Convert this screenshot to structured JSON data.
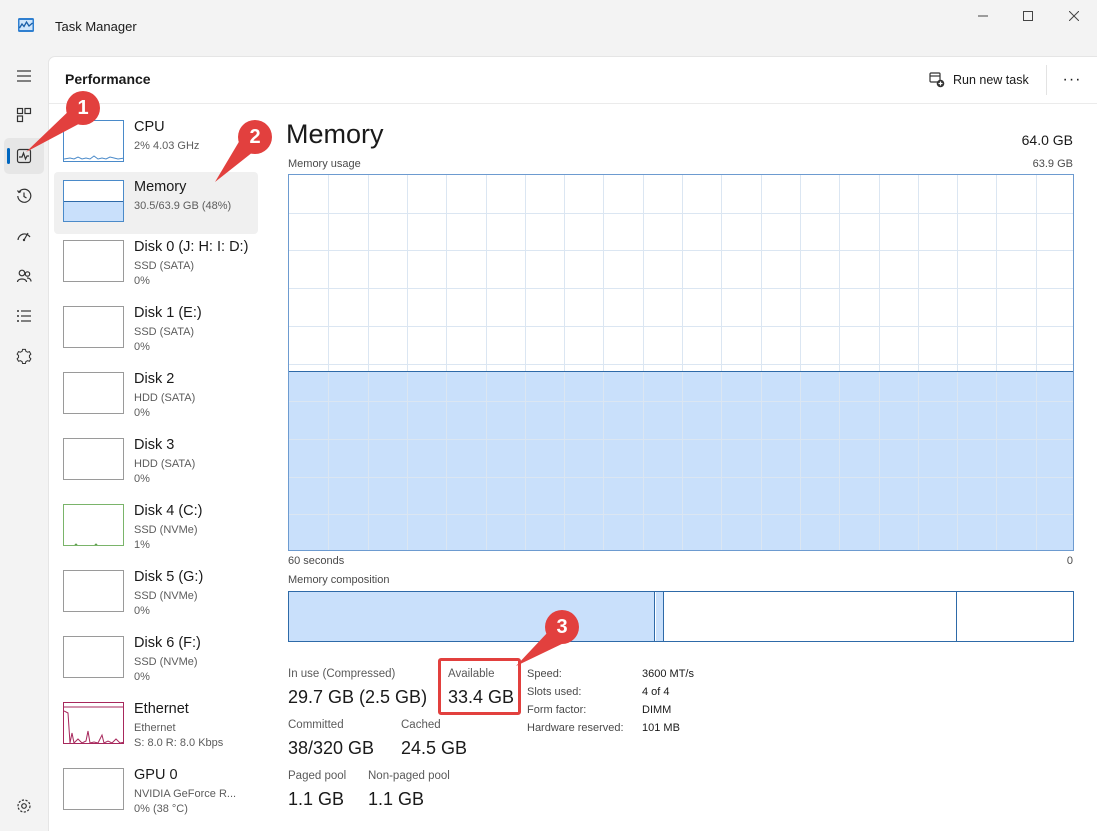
{
  "window": {
    "title": "Task Manager",
    "minimize_glyph": "—",
    "maximize_glyph": "☐",
    "close_glyph": "✕"
  },
  "nav": {
    "items": [
      {
        "icon": "hamburger-menu-icon"
      },
      {
        "icon": "processes-icon"
      },
      {
        "icon": "performance-icon",
        "active": true
      },
      {
        "icon": "app-history-icon"
      },
      {
        "icon": "startup-apps-icon"
      },
      {
        "icon": "users-icon"
      },
      {
        "icon": "details-icon"
      },
      {
        "icon": "services-icon"
      },
      {
        "icon": "settings-icon"
      }
    ]
  },
  "header": {
    "title": "Performance",
    "run_task_label": "Run new task",
    "more_glyph": "···"
  },
  "resources": [
    {
      "name": "CPU",
      "line1": "2% 4.03 GHz",
      "line2": ""
    },
    {
      "name": "Memory",
      "line1": "30.5/63.9 GB (48%)",
      "line2": "",
      "selected": true
    },
    {
      "name": "Disk 0 (J: H: I: D:)",
      "line1": "SSD (SATA)",
      "line2": "0%"
    },
    {
      "name": "Disk 1 (E:)",
      "line1": "SSD (SATA)",
      "line2": "0%"
    },
    {
      "name": "Disk 2",
      "line1": "HDD (SATA)",
      "line2": "0%"
    },
    {
      "name": "Disk 3",
      "line1": "HDD (SATA)",
      "line2": "0%"
    },
    {
      "name": "Disk 4 (C:)",
      "line1": "SSD (NVMe)",
      "line2": "1%"
    },
    {
      "name": "Disk 5 (G:)",
      "line1": "SSD (NVMe)",
      "line2": "0%"
    },
    {
      "name": "Disk 6 (F:)",
      "line1": "SSD (NVMe)",
      "line2": "0%"
    },
    {
      "name": "Ethernet",
      "line1": "Ethernet",
      "line2": "S: 8.0  R: 8.0 Kbps"
    },
    {
      "name": "GPU 0",
      "line1": "NVIDIA GeForce R...",
      "line2": "0% (38 °C)"
    }
  ],
  "detail": {
    "title": "Memory",
    "total": "64.0 GB",
    "usage_label": "Memory usage",
    "usage_max": "63.9 GB",
    "time_left": "60 seconds",
    "time_right": "0",
    "usage_fraction": 0.48,
    "composition_label": "Memory composition",
    "stats": {
      "in_use_label": "In use (Compressed)",
      "in_use_value": "29.7 GB (2.5 GB)",
      "available_label": "Available",
      "available_value": "33.4 GB",
      "committed_label": "Committed",
      "committed_value": "38/320 GB",
      "cached_label": "Cached",
      "cached_value": "24.5 GB",
      "paged_label": "Paged pool",
      "paged_value": "1.1 GB",
      "nonpaged_label": "Non-paged pool",
      "nonpaged_value": "1.1 GB"
    },
    "specs": [
      {
        "key": "Speed:",
        "value": "3600 MT/s"
      },
      {
        "key": "Slots used:",
        "value": "4 of 4"
      },
      {
        "key": "Form factor:",
        "value": "DIMM"
      },
      {
        "key": "Hardware reserved:",
        "value": "101 MB"
      }
    ]
  },
  "annotations": [
    {
      "number": "1"
    },
    {
      "number": "2"
    },
    {
      "number": "3"
    }
  ],
  "colors": {
    "accent": "#0067c0",
    "memory_fill": "#c9e0fb",
    "memory_line": "#2e6aa8",
    "ethernet": "#a7285c",
    "annotation": "#e2403e"
  }
}
